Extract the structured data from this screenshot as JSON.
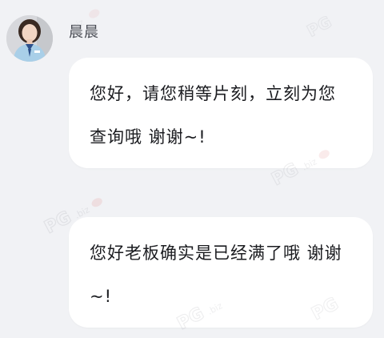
{
  "sender": {
    "name": "晨晨"
  },
  "messages": [
    {
      "text": "您好，请您稍等片刻，立刻为您查询哦 谢谢~!"
    },
    {
      "text": "您好老板确实是已经满了哦 谢谢~!"
    }
  ],
  "colors": {
    "background": "#f1f2f5",
    "bubble": "#ffffff",
    "text": "#1b1c20",
    "name": "#4a4d55"
  }
}
